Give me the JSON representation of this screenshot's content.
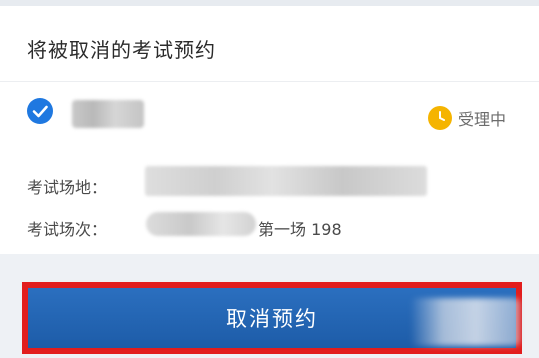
{
  "section": {
    "title": "将被取消的考试预约"
  },
  "booking": {
    "status_text": "受理中",
    "venue_label": "考试场地：",
    "session_label": "考试场次：",
    "session_value": "第一场 198"
  },
  "actions": {
    "cancel_label": "取消预约"
  },
  "colors": {
    "check_icon": "#1f78e0",
    "status_icon": "#f5b400",
    "button": "#1d5ca8",
    "highlight_border": "#e21d1d"
  },
  "icons": {
    "check": "check-circle-icon",
    "status": "clock-icon"
  }
}
